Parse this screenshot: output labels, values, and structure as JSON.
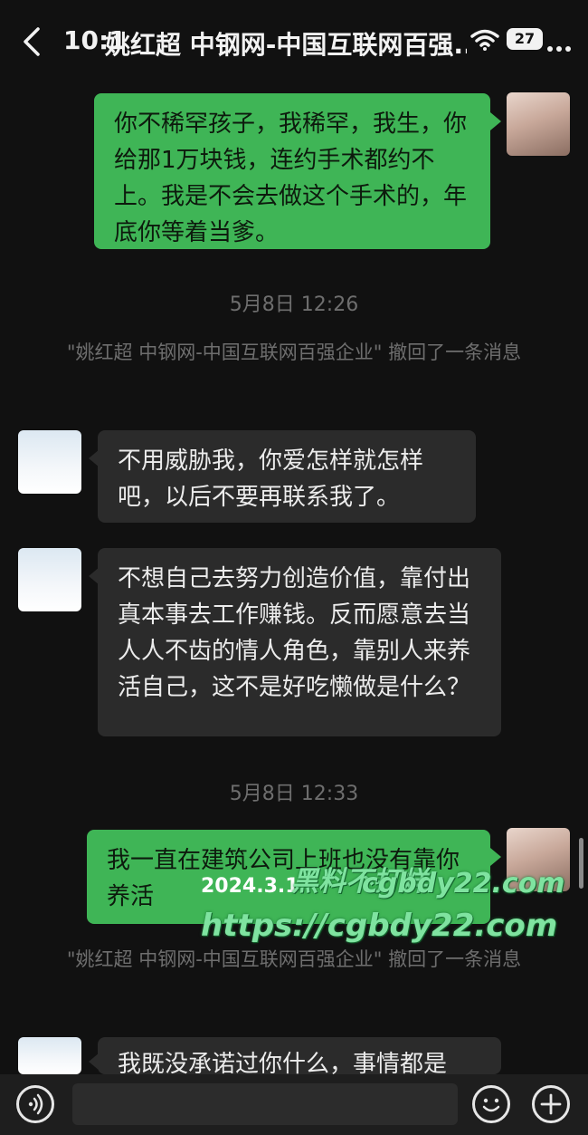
{
  "status_bar": {
    "time": "10:1",
    "battery": "27"
  },
  "header": {
    "title": "姚红超 中钢网-中国互联网百强..."
  },
  "messages": {
    "m1": "你不稀罕孩子，我稀罕，我生，你给那1万块钱，连约手术都约不上。我是不会去做这个手术的，年底你等着当爹。",
    "ts1": "5月8日 12:26",
    "recall1": "\"姚红超 中钢网-中国互联网百强企业\" 撤回了一条消息",
    "m2": "不用威胁我，你爱怎样就怎样吧，以后不要再联系我了。",
    "m3": "不想自己去努力创造价值，靠付出真本事去工作赚钱。反而愿意去当人人不齿的情人角色，靠别人来养活自己，这不是好吃懒做是什么？",
    "ts2": "5月8日 12:33",
    "m4": "我一直在建筑公司上班也没有靠你养活",
    "recall2": "\"姚红超 中钢网-中国互联网百强企业\" 撤回了一条消息",
    "m5": "我既没承诺过你什么，事情都是"
  },
  "overlay": {
    "date": "2024.3.1",
    "watermark_cn": "黑料不打烊",
    "watermark_domain": "cgbdy22.com",
    "watermark_url": "https://cgbdy22.com"
  },
  "icons": {
    "back": "chevron-left-icon",
    "wifi": "wifi-icon",
    "battery": "battery-icon",
    "more": "more-dots-icon",
    "voice": "voice-icon",
    "emoji": "emoji-icon",
    "plus": "plus-icon"
  }
}
